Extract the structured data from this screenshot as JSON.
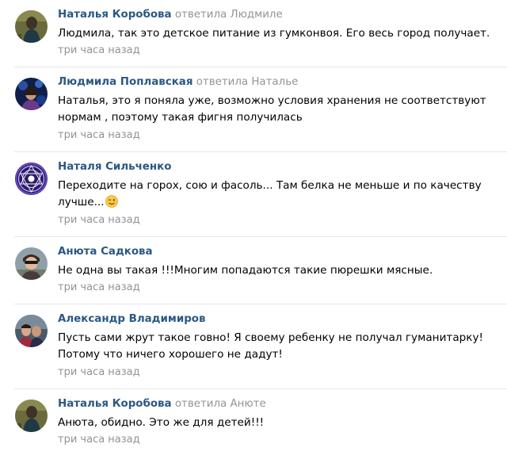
{
  "comments": [
    {
      "author": "Наталья Коробова",
      "reply_word": "ответила",
      "reply_to": "Людмиле",
      "text": "Людмила, так это детское питание из гумконвоя. Его весь город получает.",
      "time": "три часа назад",
      "avatar_icon": "avatar-photo"
    },
    {
      "author": "Людмила Поплавская",
      "reply_word": "ответила",
      "reply_to": "Наталье",
      "text": "Наталья, это я поняла уже, возможно условия хранения не соответствуют нормам , поэтому такая фигня получилась",
      "time": "три часа назад",
      "avatar_icon": "avatar-photo"
    },
    {
      "author": "Наталя Сильченко",
      "reply_word": "",
      "reply_to": "",
      "text": "Переходите на горох, сою и фасоль... Там белка не меньше и по качеству лучше...",
      "emoji": "wink-emoji",
      "time": "три часа назад",
      "avatar_icon": "avatar-mandala"
    },
    {
      "author": "Анюта Садкова",
      "reply_word": "",
      "reply_to": "",
      "text": "Не одна вы такая !!!Многим попадаются такие пюрешки мясные.",
      "time": "три часа назад",
      "avatar_icon": "avatar-photo"
    },
    {
      "author": "Александр Владимиров",
      "reply_word": "",
      "reply_to": "",
      "text": "Пусть сами жрут такое говно! Я своему ребенку не получал гуманитарку! Потому что ничего хорошего не дадут!",
      "time": "три часа назад",
      "avatar_icon": "avatar-photo"
    },
    {
      "author": "Наталья Коробова",
      "reply_word": "ответила",
      "reply_to": "Анюте",
      "text": "Анюта, обидно. Это же для детей!!!",
      "time": "три часа назад",
      "avatar_icon": "avatar-photo"
    }
  ],
  "colors": {
    "author": "#2a5885",
    "meta": "#939393",
    "text": "#000000",
    "divider": "#e7e8ec"
  }
}
